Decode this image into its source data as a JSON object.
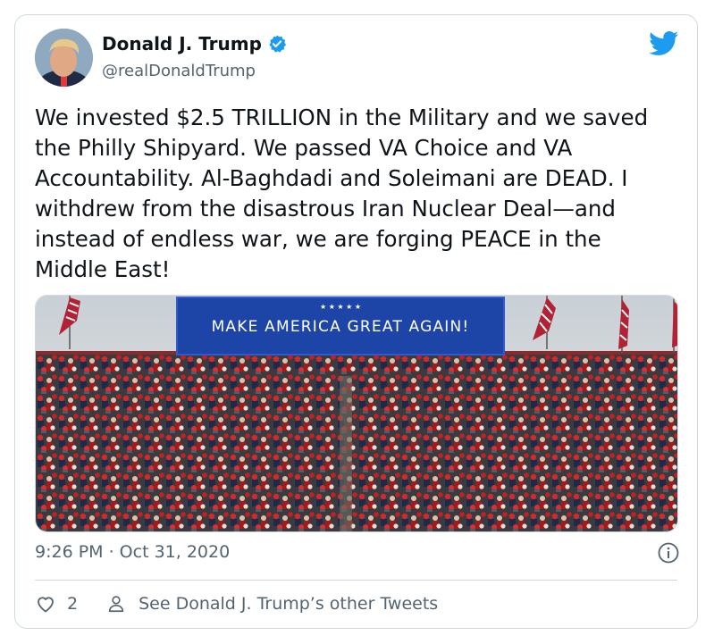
{
  "user": {
    "name": "Donald J. Trump",
    "handle": "@realDonaldTrump",
    "verified": true
  },
  "tweet": {
    "text": "We invested $2.5 TRILLION in the Military and we saved the Philly Shipyard. We passed VA Choice and VA Accountability. Al-Baghdadi and Soleimani are DEAD. I withdrew from the disastrous Iran Nuclear Deal—and instead of endless war, we are forging PEACE in the Middle East!",
    "timestamp": "9:26 PM · Oct 31, 2020",
    "likes": "2",
    "see_other": "See Donald J. Trump’s other Tweets"
  },
  "media": {
    "banner_text": "MAKE AMERICA GREAT AGAIN!",
    "banner_stars": "★ ★ ★ ★ ★"
  },
  "colors": {
    "twitter_blue": "#1d9bf0",
    "text_secondary": "#536471",
    "banner_blue": "#1d45a8"
  },
  "icons": [
    "twitter-bird-icon",
    "verified-badge-icon",
    "info-icon",
    "heart-icon",
    "person-icon"
  ]
}
